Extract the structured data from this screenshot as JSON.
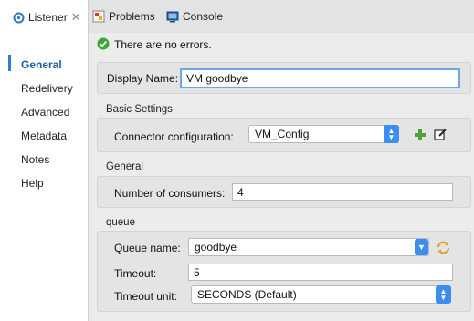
{
  "tabs": [
    {
      "label": "Listener"
    },
    {
      "label": "Problems"
    },
    {
      "label": "Console"
    }
  ],
  "nav": [
    "General",
    "Redelivery",
    "Advanced",
    "Metadata",
    "Notes",
    "Help"
  ],
  "status": {
    "text": "There are no errors."
  },
  "display_name": {
    "label": "Display Name:",
    "value": "VM goodbye"
  },
  "basic_settings": {
    "title": "Basic Settings",
    "connector_label": "Connector configuration:",
    "connector_value": "VM_Config"
  },
  "general": {
    "title": "General",
    "consumers_label": "Number of consumers:",
    "consumers_value": "4"
  },
  "queue": {
    "title": "queue",
    "name_label": "Queue name:",
    "name_value": "goodbye",
    "timeout_label": "Timeout:",
    "timeout_value": "5",
    "unit_label": "Timeout unit:",
    "unit_value": "SECONDS (Default)"
  }
}
